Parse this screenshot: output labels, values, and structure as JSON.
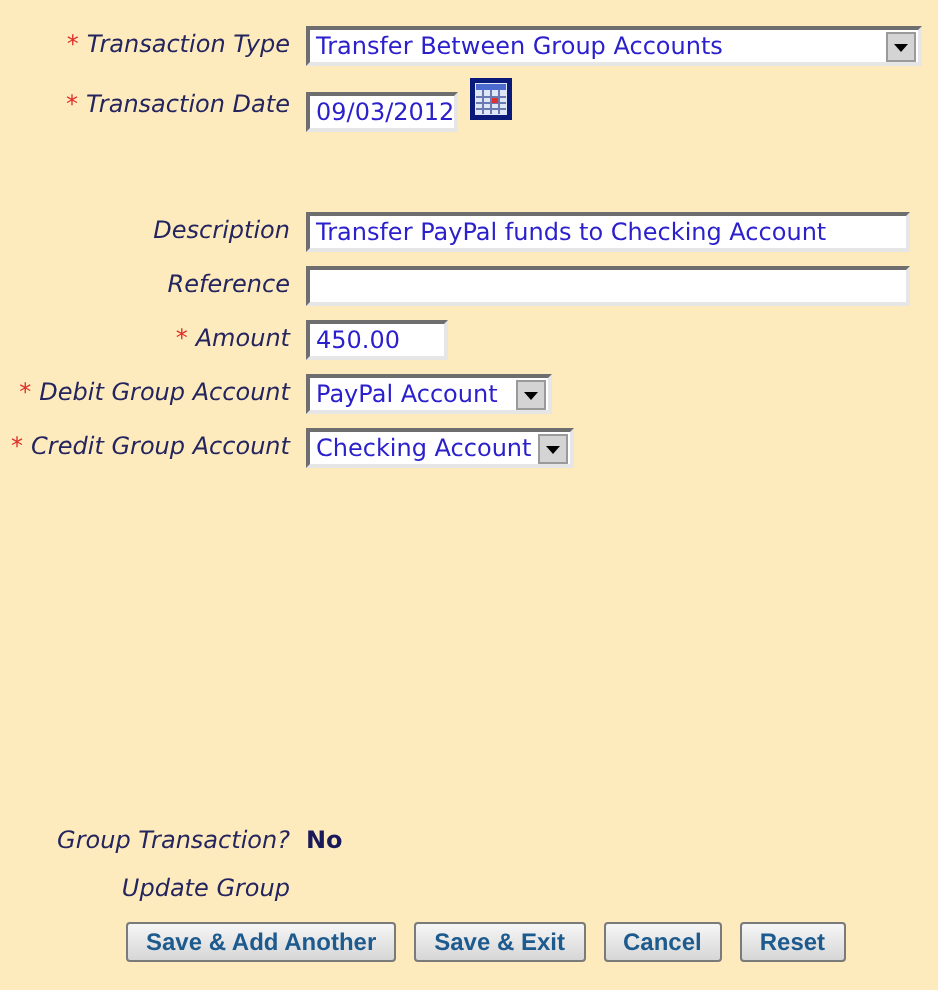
{
  "header_fields": [
    {
      "label": "Transaction Type",
      "required_mark": "*",
      "kind": "select",
      "value": "Transfer Between Group Accounts"
    },
    {
      "label": "Transaction Date",
      "required_mark": "*",
      "kind": "date",
      "value": "09/03/2012"
    }
  ],
  "detail_fields": [
    {
      "label": "Description",
      "kind": "text",
      "value": "Transfer PayPal funds to Checking Account"
    },
    {
      "label": "Reference",
      "kind": "text"
    },
    {
      "label": "Amount",
      "required_mark": "*",
      "kind": "text",
      "value": "450.00"
    },
    {
      "label": "Debit Group Account",
      "required_mark": "*",
      "kind": "select",
      "value": "PayPal Account"
    },
    {
      "label": "Credit Group Account",
      "required_mark": "*",
      "kind": "select",
      "value": "Checking Account"
    }
  ],
  "group_transaction": {
    "label": "Group Transaction?",
    "value": "No"
  },
  "update_group": {
    "label": "Update Group"
  },
  "buttons": [
    "Save & Add Another",
    "Save & Exit",
    "Cancel",
    "Reset"
  ]
}
